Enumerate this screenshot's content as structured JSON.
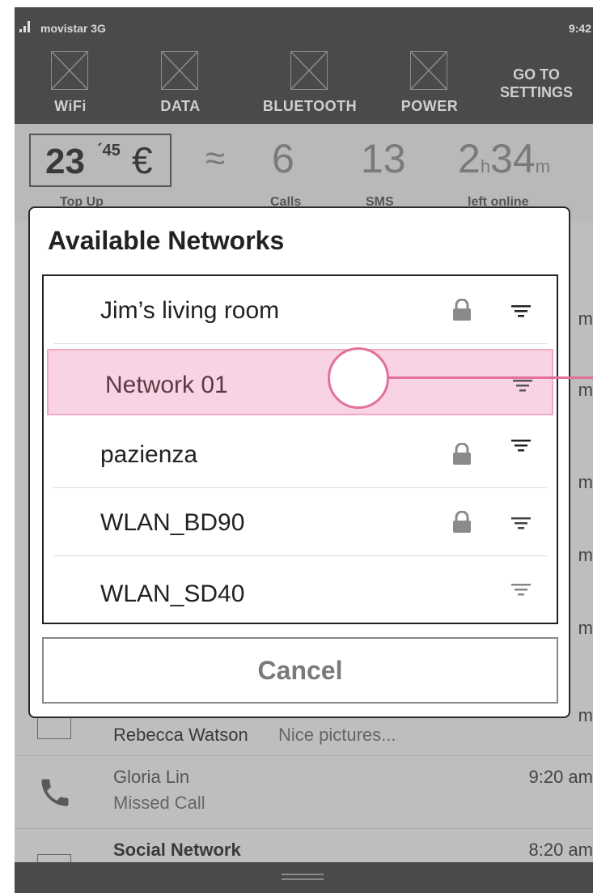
{
  "status_bar": {
    "carrier": "movistar 3G",
    "time": "9:42"
  },
  "toggles": [
    {
      "label": "WiFi"
    },
    {
      "label": "DATA"
    },
    {
      "label": "BLUETOOTH"
    },
    {
      "label": "POWER"
    }
  ],
  "goto_settings": {
    "line1": "GO TO",
    "line2": "SETTINGS"
  },
  "stats": {
    "balance_int": "23",
    "balance_cents": "´45",
    "currency": "€",
    "approx": "≈",
    "calls": "6",
    "sms": "13",
    "hours": "2",
    "hours_unit": "h",
    "minutes": "34",
    "minutes_unit": "m",
    "labels": {
      "topup": "Top Up",
      "calls": "Calls",
      "sms": "SMS",
      "left": "left online"
    }
  },
  "background_list": {
    "rows": [
      {
        "name": "Rebecca Watson",
        "sub": "Nice pictures...",
        "time": "m"
      },
      {
        "name": "Gloria Lin",
        "sub": "Missed Call",
        "time": "9:20 am"
      },
      {
        "name": "Social Network",
        "time": "8:20 am"
      }
    ],
    "partial_times": [
      "m",
      "m",
      "m",
      "m",
      "m"
    ]
  },
  "dialog": {
    "title": "Available Networks",
    "networks": [
      {
        "name": "Jim’s living room",
        "locked": true,
        "selected": false
      },
      {
        "name": "Network 01",
        "locked": false,
        "selected": true
      },
      {
        "name": "pazienza",
        "locked": true,
        "selected": false
      },
      {
        "name": "WLAN_BD90",
        "locked": true,
        "selected": false
      },
      {
        "name": "WLAN_SD40",
        "locked": false,
        "selected": false
      }
    ],
    "cancel_label": "Cancel"
  },
  "colors": {
    "highlight": "#f8d3e3",
    "cursor": "#e2709a",
    "dark_bar": "#4a4a4a"
  }
}
